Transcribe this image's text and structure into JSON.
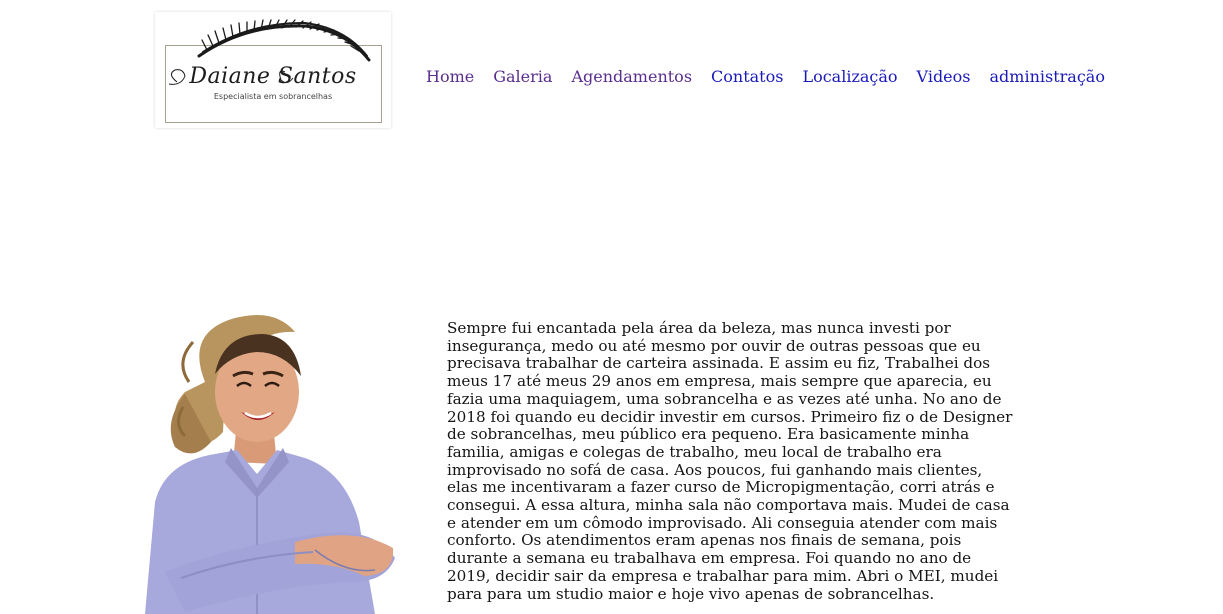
{
  "header": {
    "logo": {
      "name": "Daiane Santos",
      "tagline": "Especialista em sobrancelhas"
    },
    "nav": [
      {
        "label": "Home",
        "state": "visited"
      },
      {
        "label": "Galeria",
        "state": "visited"
      },
      {
        "label": "Agendamentos",
        "state": "visited"
      },
      {
        "label": "Contatos",
        "state": "link"
      },
      {
        "label": "Localização",
        "state": "link"
      },
      {
        "label": "Videos",
        "state": "link"
      },
      {
        "label": "administração",
        "state": "link"
      }
    ]
  },
  "about": {
    "text": "Sempre fui encantada pela área da beleza, mas nunca investi por insegurança, medo ou até mesmo por ouvir de outras pessoas que eu precisava trabalhar de carteira assinada. E assim eu fiz, Trabalhei dos meus 17 até meus 29 anos em empresa, mais sempre que aparecia, eu fazia uma maquiagem, uma sobrancelha e as vezes até unha. No ano de 2018 foi quando eu decidir investir em cursos. Primeiro fiz o de Designer de sobrancelhas, meu público era pequeno. Era basicamente minha familia, amigas e colegas de trabalho, meu local de trabalho era improvisado no sofá de casa. Aos poucos, fui ganhando mais clientes, elas me incentivaram a fazer curso de Micropigmentação, corri atrás e consegui. A essa altura, minha sala não comportava mais. Mudei de casa e atender em um cômodo improvisado. Ali conseguia atender com mais conforto. Os atendimentos eram apenas nos finais de semana, pois durante a semana eu trabalhava em empresa. Foi quando no ano de 2019, decidir sair da empresa e trabalhar para mim. Abri o MEI, mudei para para um studio maior e hoje vivo apenas de sobrancelhas."
  },
  "colors": {
    "link": "#1a1ab8",
    "visited": "#5a2e8e",
    "text": "#151515",
    "background": "#ffffff"
  }
}
